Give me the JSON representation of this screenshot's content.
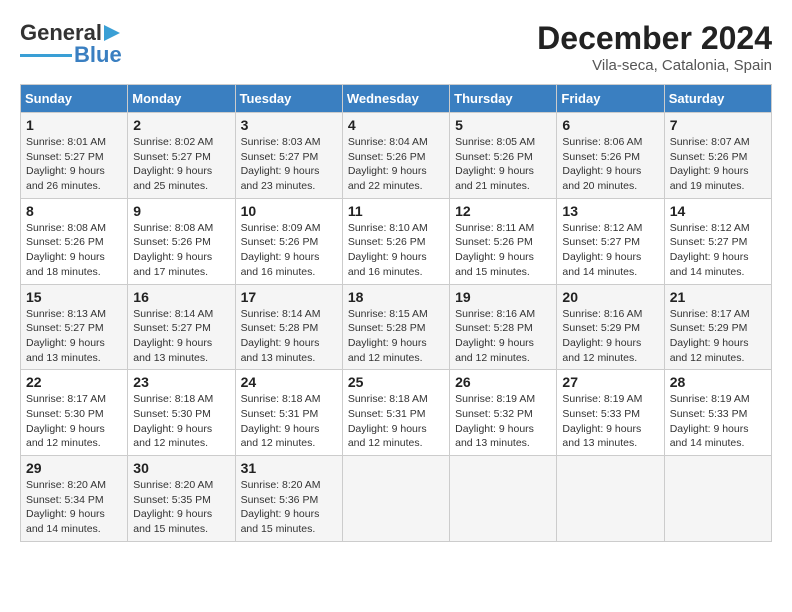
{
  "logo": {
    "line1": "General",
    "line2": "Blue"
  },
  "title": "December 2024",
  "subtitle": "Vila-seca, Catalonia, Spain",
  "headers": [
    "Sunday",
    "Monday",
    "Tuesday",
    "Wednesday",
    "Thursday",
    "Friday",
    "Saturday"
  ],
  "weeks": [
    [
      {
        "day": "1",
        "sunrise": "Sunrise: 8:01 AM",
        "sunset": "Sunset: 5:27 PM",
        "daylight": "Daylight: 9 hours and 26 minutes."
      },
      {
        "day": "2",
        "sunrise": "Sunrise: 8:02 AM",
        "sunset": "Sunset: 5:27 PM",
        "daylight": "Daylight: 9 hours and 25 minutes."
      },
      {
        "day": "3",
        "sunrise": "Sunrise: 8:03 AM",
        "sunset": "Sunset: 5:27 PM",
        "daylight": "Daylight: 9 hours and 23 minutes."
      },
      {
        "day": "4",
        "sunrise": "Sunrise: 8:04 AM",
        "sunset": "Sunset: 5:26 PM",
        "daylight": "Daylight: 9 hours and 22 minutes."
      },
      {
        "day": "5",
        "sunrise": "Sunrise: 8:05 AM",
        "sunset": "Sunset: 5:26 PM",
        "daylight": "Daylight: 9 hours and 21 minutes."
      },
      {
        "day": "6",
        "sunrise": "Sunrise: 8:06 AM",
        "sunset": "Sunset: 5:26 PM",
        "daylight": "Daylight: 9 hours and 20 minutes."
      },
      {
        "day": "7",
        "sunrise": "Sunrise: 8:07 AM",
        "sunset": "Sunset: 5:26 PM",
        "daylight": "Daylight: 9 hours and 19 minutes."
      }
    ],
    [
      {
        "day": "8",
        "sunrise": "Sunrise: 8:08 AM",
        "sunset": "Sunset: 5:26 PM",
        "daylight": "Daylight: 9 hours and 18 minutes."
      },
      {
        "day": "9",
        "sunrise": "Sunrise: 8:08 AM",
        "sunset": "Sunset: 5:26 PM",
        "daylight": "Daylight: 9 hours and 17 minutes."
      },
      {
        "day": "10",
        "sunrise": "Sunrise: 8:09 AM",
        "sunset": "Sunset: 5:26 PM",
        "daylight": "Daylight: 9 hours and 16 minutes."
      },
      {
        "day": "11",
        "sunrise": "Sunrise: 8:10 AM",
        "sunset": "Sunset: 5:26 PM",
        "daylight": "Daylight: 9 hours and 16 minutes."
      },
      {
        "day": "12",
        "sunrise": "Sunrise: 8:11 AM",
        "sunset": "Sunset: 5:26 PM",
        "daylight": "Daylight: 9 hours and 15 minutes."
      },
      {
        "day": "13",
        "sunrise": "Sunrise: 8:12 AM",
        "sunset": "Sunset: 5:27 PM",
        "daylight": "Daylight: 9 hours and 14 minutes."
      },
      {
        "day": "14",
        "sunrise": "Sunrise: 8:12 AM",
        "sunset": "Sunset: 5:27 PM",
        "daylight": "Daylight: 9 hours and 14 minutes."
      }
    ],
    [
      {
        "day": "15",
        "sunrise": "Sunrise: 8:13 AM",
        "sunset": "Sunset: 5:27 PM",
        "daylight": "Daylight: 9 hours and 13 minutes."
      },
      {
        "day": "16",
        "sunrise": "Sunrise: 8:14 AM",
        "sunset": "Sunset: 5:27 PM",
        "daylight": "Daylight: 9 hours and 13 minutes."
      },
      {
        "day": "17",
        "sunrise": "Sunrise: 8:14 AM",
        "sunset": "Sunset: 5:28 PM",
        "daylight": "Daylight: 9 hours and 13 minutes."
      },
      {
        "day": "18",
        "sunrise": "Sunrise: 8:15 AM",
        "sunset": "Sunset: 5:28 PM",
        "daylight": "Daylight: 9 hours and 12 minutes."
      },
      {
        "day": "19",
        "sunrise": "Sunrise: 8:16 AM",
        "sunset": "Sunset: 5:28 PM",
        "daylight": "Daylight: 9 hours and 12 minutes."
      },
      {
        "day": "20",
        "sunrise": "Sunrise: 8:16 AM",
        "sunset": "Sunset: 5:29 PM",
        "daylight": "Daylight: 9 hours and 12 minutes."
      },
      {
        "day": "21",
        "sunrise": "Sunrise: 8:17 AM",
        "sunset": "Sunset: 5:29 PM",
        "daylight": "Daylight: 9 hours and 12 minutes."
      }
    ],
    [
      {
        "day": "22",
        "sunrise": "Sunrise: 8:17 AM",
        "sunset": "Sunset: 5:30 PM",
        "daylight": "Daylight: 9 hours and 12 minutes."
      },
      {
        "day": "23",
        "sunrise": "Sunrise: 8:18 AM",
        "sunset": "Sunset: 5:30 PM",
        "daylight": "Daylight: 9 hours and 12 minutes."
      },
      {
        "day": "24",
        "sunrise": "Sunrise: 8:18 AM",
        "sunset": "Sunset: 5:31 PM",
        "daylight": "Daylight: 9 hours and 12 minutes."
      },
      {
        "day": "25",
        "sunrise": "Sunrise: 8:18 AM",
        "sunset": "Sunset: 5:31 PM",
        "daylight": "Daylight: 9 hours and 12 minutes."
      },
      {
        "day": "26",
        "sunrise": "Sunrise: 8:19 AM",
        "sunset": "Sunset: 5:32 PM",
        "daylight": "Daylight: 9 hours and 13 minutes."
      },
      {
        "day": "27",
        "sunrise": "Sunrise: 8:19 AM",
        "sunset": "Sunset: 5:33 PM",
        "daylight": "Daylight: 9 hours and 13 minutes."
      },
      {
        "day": "28",
        "sunrise": "Sunrise: 8:19 AM",
        "sunset": "Sunset: 5:33 PM",
        "daylight": "Daylight: 9 hours and 14 minutes."
      }
    ],
    [
      {
        "day": "29",
        "sunrise": "Sunrise: 8:20 AM",
        "sunset": "Sunset: 5:34 PM",
        "daylight": "Daylight: 9 hours and 14 minutes."
      },
      {
        "day": "30",
        "sunrise": "Sunrise: 8:20 AM",
        "sunset": "Sunset: 5:35 PM",
        "daylight": "Daylight: 9 hours and 15 minutes."
      },
      {
        "day": "31",
        "sunrise": "Sunrise: 8:20 AM",
        "sunset": "Sunset: 5:36 PM",
        "daylight": "Daylight: 9 hours and 15 minutes."
      },
      null,
      null,
      null,
      null
    ]
  ]
}
